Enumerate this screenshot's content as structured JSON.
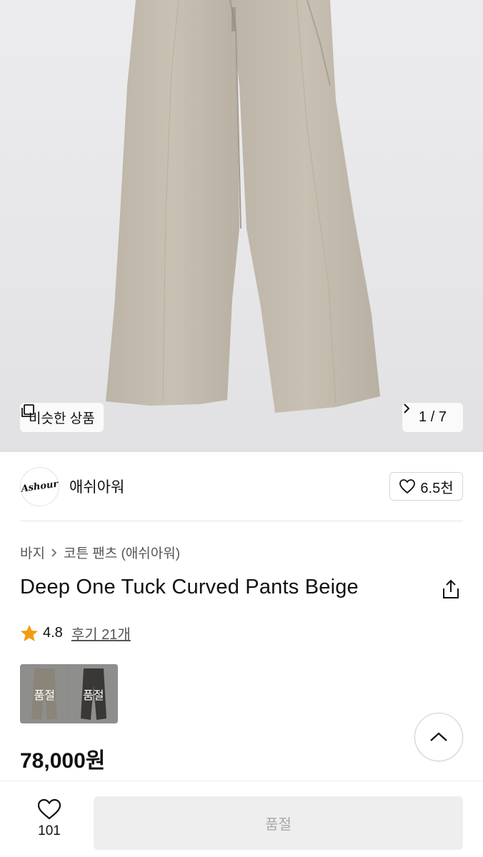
{
  "hero": {
    "similar_label": "비슷한 상품",
    "pager_text": "1 / 7",
    "icons": {
      "similar": "stacked-squares-icon",
      "next": "chevron-right-icon"
    }
  },
  "brand": {
    "logo_text": "Ashour",
    "name": "애쉬아워",
    "likes": "6.5천"
  },
  "breadcrumb": {
    "category": "바지",
    "subcategory": "코튼 팬츠 (애쉬아워)"
  },
  "product": {
    "title": "Deep One Tuck Curved Pants Beige",
    "rating": "4.8",
    "reviews_label": "후기 21개",
    "price": "78,000원",
    "star_color": "#f39c12"
  },
  "options": [
    {
      "label": "품절",
      "color": "#8b8478"
    },
    {
      "label": "품절",
      "color": "#3a3835"
    }
  ],
  "bottom": {
    "wish_count": "101",
    "buy_label": "품절"
  }
}
